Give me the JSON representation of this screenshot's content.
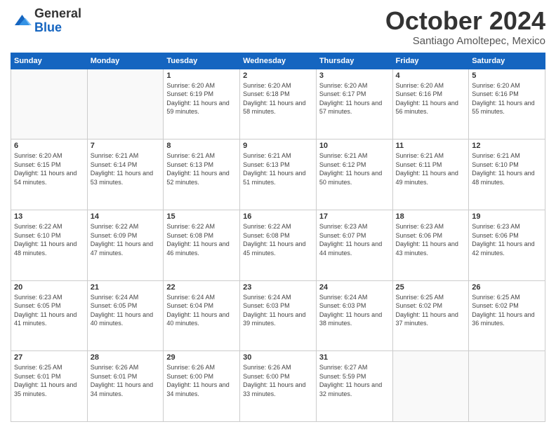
{
  "logo": {
    "general": "General",
    "blue": "Blue"
  },
  "header": {
    "month": "October 2024",
    "location": "Santiago Amoltepec, Mexico"
  },
  "days_of_week": [
    "Sunday",
    "Monday",
    "Tuesday",
    "Wednesday",
    "Thursday",
    "Friday",
    "Saturday"
  ],
  "weeks": [
    [
      {
        "day": "",
        "info": ""
      },
      {
        "day": "",
        "info": ""
      },
      {
        "day": "1",
        "info": "Sunrise: 6:20 AM\nSunset: 6:19 PM\nDaylight: 11 hours and 59 minutes."
      },
      {
        "day": "2",
        "info": "Sunrise: 6:20 AM\nSunset: 6:18 PM\nDaylight: 11 hours and 58 minutes."
      },
      {
        "day": "3",
        "info": "Sunrise: 6:20 AM\nSunset: 6:17 PM\nDaylight: 11 hours and 57 minutes."
      },
      {
        "day": "4",
        "info": "Sunrise: 6:20 AM\nSunset: 6:16 PM\nDaylight: 11 hours and 56 minutes."
      },
      {
        "day": "5",
        "info": "Sunrise: 6:20 AM\nSunset: 6:16 PM\nDaylight: 11 hours and 55 minutes."
      }
    ],
    [
      {
        "day": "6",
        "info": "Sunrise: 6:20 AM\nSunset: 6:15 PM\nDaylight: 11 hours and 54 minutes."
      },
      {
        "day": "7",
        "info": "Sunrise: 6:21 AM\nSunset: 6:14 PM\nDaylight: 11 hours and 53 minutes."
      },
      {
        "day": "8",
        "info": "Sunrise: 6:21 AM\nSunset: 6:13 PM\nDaylight: 11 hours and 52 minutes."
      },
      {
        "day": "9",
        "info": "Sunrise: 6:21 AM\nSunset: 6:13 PM\nDaylight: 11 hours and 51 minutes."
      },
      {
        "day": "10",
        "info": "Sunrise: 6:21 AM\nSunset: 6:12 PM\nDaylight: 11 hours and 50 minutes."
      },
      {
        "day": "11",
        "info": "Sunrise: 6:21 AM\nSunset: 6:11 PM\nDaylight: 11 hours and 49 minutes."
      },
      {
        "day": "12",
        "info": "Sunrise: 6:21 AM\nSunset: 6:10 PM\nDaylight: 11 hours and 48 minutes."
      }
    ],
    [
      {
        "day": "13",
        "info": "Sunrise: 6:22 AM\nSunset: 6:10 PM\nDaylight: 11 hours and 48 minutes."
      },
      {
        "day": "14",
        "info": "Sunrise: 6:22 AM\nSunset: 6:09 PM\nDaylight: 11 hours and 47 minutes."
      },
      {
        "day": "15",
        "info": "Sunrise: 6:22 AM\nSunset: 6:08 PM\nDaylight: 11 hours and 46 minutes."
      },
      {
        "day": "16",
        "info": "Sunrise: 6:22 AM\nSunset: 6:08 PM\nDaylight: 11 hours and 45 minutes."
      },
      {
        "day": "17",
        "info": "Sunrise: 6:23 AM\nSunset: 6:07 PM\nDaylight: 11 hours and 44 minutes."
      },
      {
        "day": "18",
        "info": "Sunrise: 6:23 AM\nSunset: 6:06 PM\nDaylight: 11 hours and 43 minutes."
      },
      {
        "day": "19",
        "info": "Sunrise: 6:23 AM\nSunset: 6:06 PM\nDaylight: 11 hours and 42 minutes."
      }
    ],
    [
      {
        "day": "20",
        "info": "Sunrise: 6:23 AM\nSunset: 6:05 PM\nDaylight: 11 hours and 41 minutes."
      },
      {
        "day": "21",
        "info": "Sunrise: 6:24 AM\nSunset: 6:05 PM\nDaylight: 11 hours and 40 minutes."
      },
      {
        "day": "22",
        "info": "Sunrise: 6:24 AM\nSunset: 6:04 PM\nDaylight: 11 hours and 40 minutes."
      },
      {
        "day": "23",
        "info": "Sunrise: 6:24 AM\nSunset: 6:03 PM\nDaylight: 11 hours and 39 minutes."
      },
      {
        "day": "24",
        "info": "Sunrise: 6:24 AM\nSunset: 6:03 PM\nDaylight: 11 hours and 38 minutes."
      },
      {
        "day": "25",
        "info": "Sunrise: 6:25 AM\nSunset: 6:02 PM\nDaylight: 11 hours and 37 minutes."
      },
      {
        "day": "26",
        "info": "Sunrise: 6:25 AM\nSunset: 6:02 PM\nDaylight: 11 hours and 36 minutes."
      }
    ],
    [
      {
        "day": "27",
        "info": "Sunrise: 6:25 AM\nSunset: 6:01 PM\nDaylight: 11 hours and 35 minutes."
      },
      {
        "day": "28",
        "info": "Sunrise: 6:26 AM\nSunset: 6:01 PM\nDaylight: 11 hours and 34 minutes."
      },
      {
        "day": "29",
        "info": "Sunrise: 6:26 AM\nSunset: 6:00 PM\nDaylight: 11 hours and 34 minutes."
      },
      {
        "day": "30",
        "info": "Sunrise: 6:26 AM\nSunset: 6:00 PM\nDaylight: 11 hours and 33 minutes."
      },
      {
        "day": "31",
        "info": "Sunrise: 6:27 AM\nSunset: 5:59 PM\nDaylight: 11 hours and 32 minutes."
      },
      {
        "day": "",
        "info": ""
      },
      {
        "day": "",
        "info": ""
      }
    ]
  ]
}
